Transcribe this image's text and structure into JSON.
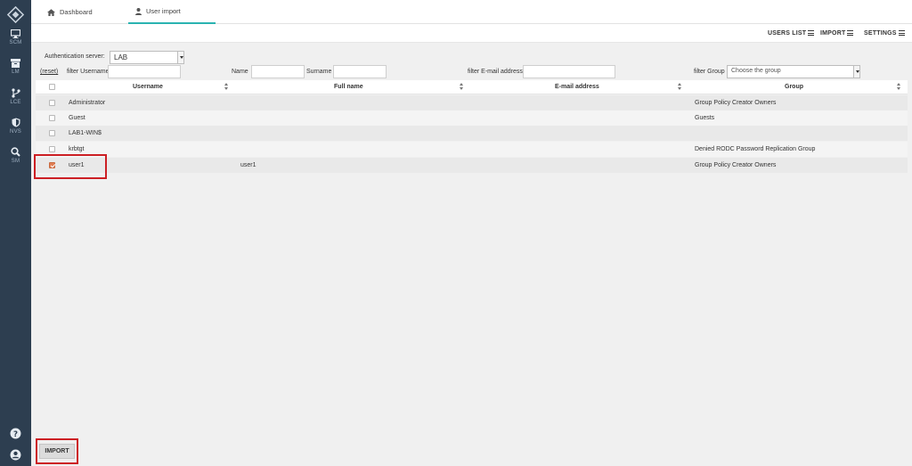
{
  "sidebar": {
    "items": [
      {
        "label": "SCM",
        "icon": "monitor-icon"
      },
      {
        "label": "LM",
        "icon": "archive-icon"
      },
      {
        "label": "LCE",
        "icon": "branch-icon"
      },
      {
        "label": "NVS",
        "icon": "shield-icon"
      },
      {
        "label": "SM",
        "icon": "search-icon"
      }
    ],
    "bottom": [
      {
        "icon": "help-icon"
      },
      {
        "icon": "user-circle-icon"
      }
    ]
  },
  "tabs": [
    {
      "label": "Dashboard",
      "icon": "home-icon",
      "active": false
    },
    {
      "label": "User import",
      "icon": "user-icon",
      "active": true
    }
  ],
  "toolbar": {
    "users_list": "USERS LIST",
    "import": "IMPORT",
    "settings": "SETTINGS"
  },
  "form": {
    "auth_server_label": "Authentication server:",
    "auth_server_value": "LAB",
    "reset": "reset",
    "filter_username_label": "filter Username",
    "name_label": "Name",
    "surname_label": "Surname",
    "filter_email_label": "filter E-mail address",
    "filter_group_label": "filter Group",
    "filter_group_placeholder": "Choose the group"
  },
  "table": {
    "headers": {
      "username": "Username",
      "fullname": "Full name",
      "email": "E-mail address",
      "group": "Group"
    },
    "rows": [
      {
        "username": "Administrator",
        "fullname": "",
        "email": "",
        "group": "Group Policy Creator Owners",
        "checked": false
      },
      {
        "username": "Guest",
        "fullname": "",
        "email": "",
        "group": "Guests",
        "checked": false
      },
      {
        "username": "LAB1-WIN$",
        "fullname": "",
        "email": "",
        "group": "",
        "checked": false
      },
      {
        "username": "krbtgt",
        "fullname": "",
        "email": "",
        "group": "Denied RODC Password Replication Group",
        "checked": false
      },
      {
        "username": "user1",
        "fullname": "user1",
        "email": "",
        "group": "Group Policy Creator Owners",
        "checked": true
      }
    ]
  },
  "import_button": "IMPORT",
  "colors": {
    "sidebar": "#2d3e50",
    "accent": "#2ab3b1",
    "highlight": "#cc1f24",
    "checked": "#e07e54"
  }
}
